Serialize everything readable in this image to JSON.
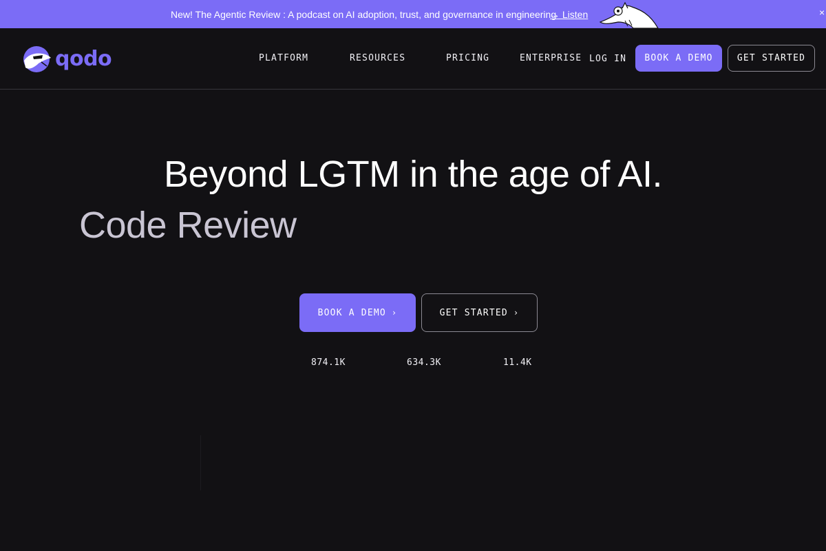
{
  "banner": {
    "text": "New! The Agentic Review : A podcast on AI adoption, trust, and governance in engineering",
    "link_label": "→ Listen",
    "close_icon": "×",
    "mascot_icon": "anteater-mascot-icon"
  },
  "header": {
    "logo_text": "qodo",
    "logo_icon": "qodo-mascot-logo-icon",
    "nav": {
      "platform": "PLATFORM",
      "resources": "RESOURCES",
      "pricing": "PRICING",
      "enterprise": "ENTERPRISE",
      "login": "LOG IN"
    },
    "book_demo_label": "BOOK A DEMO",
    "get_started_label": "GET STARTED"
  },
  "hero": {
    "title": "Beyond LGTM in the age of AI.",
    "subtitle": "Code Review",
    "book_demo_label": "BOOK A DEMO",
    "get_started_label": "GET STARTED",
    "chevron": "›"
  },
  "stats": [
    "874.1K",
    "634.3K",
    "11.4K"
  ],
  "colors": {
    "accent": "#7b6cf6",
    "background": "#121114",
    "subtitle": "#c9c5d3"
  }
}
